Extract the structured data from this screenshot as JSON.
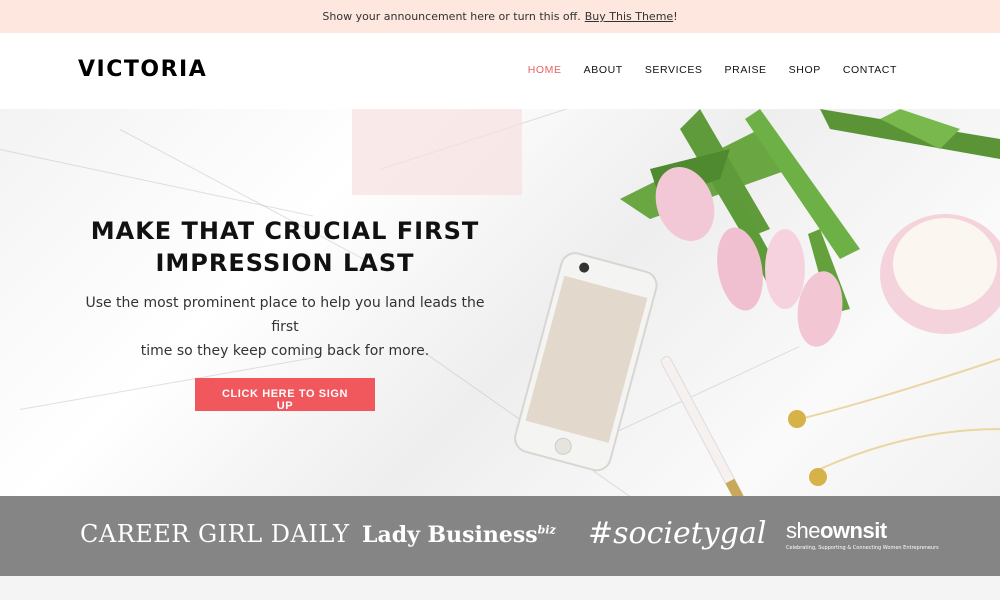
{
  "announcement": {
    "text": "Show your announcement here or turn this off.",
    "link_text": "Buy This Theme",
    "suffix": "!"
  },
  "header": {
    "logo": "VICTORIA",
    "nav": [
      {
        "label": "HOME",
        "active": true
      },
      {
        "label": "ABOUT"
      },
      {
        "label": "SERVICES"
      },
      {
        "label": "PRAISE"
      },
      {
        "label": "SHOP"
      },
      {
        "label": "CONTACT"
      }
    ]
  },
  "hero": {
    "title_line1": "MAKE THAT CRUCIAL FIRST",
    "title_line2": "IMPRESSION LAST",
    "subtitle_line1": "Use the most prominent place to help you land leads the first",
    "subtitle_line2": "time so they keep coming back for more.",
    "cta_label": "CLICK HERE TO SIGN UP"
  },
  "press": {
    "logo1": "CAREER GIRL DAILY",
    "logo2": "Lady Business",
    "logo2_sup": "biz",
    "logo3": "#societygal",
    "logo4_a": "she",
    "logo4_b": "ownsit",
    "logo4_tag": "Celebrating, Supporting & Connecting Women Entrepreneurs"
  },
  "colors": {
    "accent": "#f0585e",
    "announcement_bg": "#fde7df",
    "press_bg": "#858585"
  }
}
